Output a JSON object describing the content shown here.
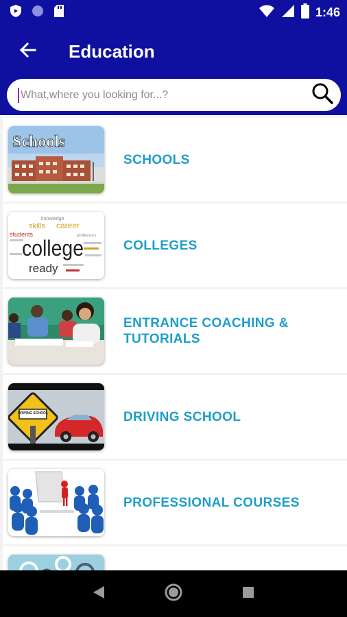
{
  "status_bar": {
    "time": "1:46",
    "icons": [
      "shield-icon",
      "circle-icon",
      "sd-card-icon",
      "wifi-icon",
      "signal-icon",
      "battery-icon"
    ]
  },
  "toolbar": {
    "title": "Education",
    "back_icon": "arrow-left-icon"
  },
  "search": {
    "placeholder": "What,where you looking for...?",
    "value": "",
    "icon": "search-icon"
  },
  "categories": [
    {
      "label": "SCHOOLS",
      "thumb_text": "Schools"
    },
    {
      "label": "COLLEGES",
      "thumb_text": "college"
    },
    {
      "label": "ENTRANCE COACHING & TUTORIALS"
    },
    {
      "label": "DRIVING SCHOOL",
      "thumb_text": "DRIVING SCHOOL"
    },
    {
      "label": "PROFESSIONAL COURSES"
    },
    {
      "label": ""
    }
  ],
  "college_words": [
    "knowledge",
    "skills",
    "career",
    "students",
    "ready",
    "professors"
  ],
  "nav_bar": {
    "icons": [
      "back-triangle-icon",
      "home-circle-icon",
      "recents-square-icon"
    ]
  },
  "colors": {
    "app_bar": "#1010a0",
    "label": "#1e9ec8",
    "nav_bar": "#000000"
  }
}
